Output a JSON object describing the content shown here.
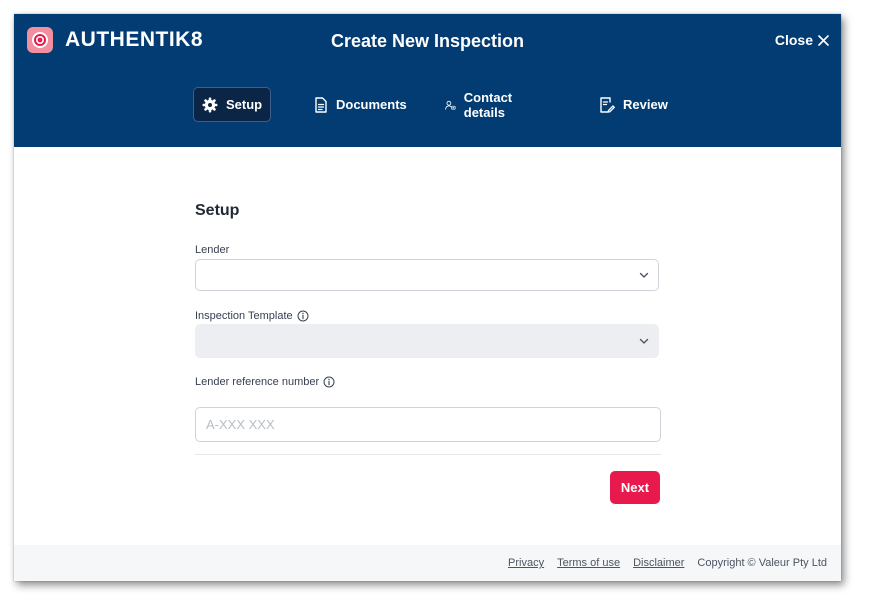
{
  "header": {
    "logo_text": "AUTHENTIK8",
    "title": "Create New Inspection",
    "close_label": "Close"
  },
  "tabs": [
    {
      "label": "Setup",
      "icon": "gear-icon",
      "active": true
    },
    {
      "label": "Documents",
      "icon": "document-icon",
      "active": false
    },
    {
      "label": "Contact details",
      "icon": "contact-icon",
      "active": false
    },
    {
      "label": "Review",
      "icon": "review-icon",
      "active": false
    }
  ],
  "form": {
    "section_title": "Setup",
    "lender_label": "Lender",
    "lender_value": "",
    "template_label": "Inspection Template",
    "template_value": "",
    "reference_label": "Lender reference number",
    "reference_placeholder": "A-XXX XXX",
    "reference_value": "",
    "next_label": "Next"
  },
  "footer": {
    "privacy": "Privacy",
    "terms": "Terms of use",
    "disclaimer": "Disclaimer",
    "copyright": "Copyright © Valeur Pty Ltd"
  },
  "colors": {
    "header_bg": "#033c73",
    "active_tab_bg": "#0b2547",
    "primary_button": "#e8194c",
    "logo_bg": "#f28f9f"
  }
}
